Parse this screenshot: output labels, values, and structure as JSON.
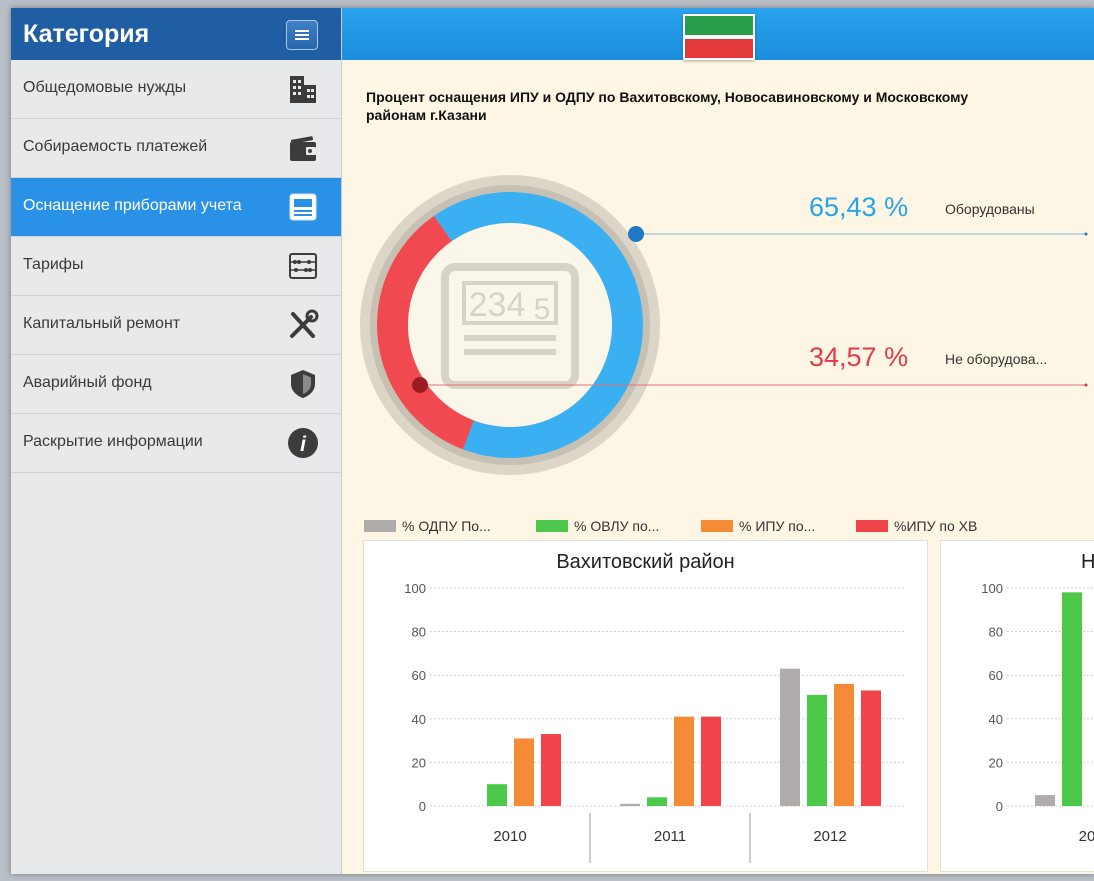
{
  "sidebar": {
    "title": "Категория",
    "items": [
      {
        "label": "Общедомовые нужды",
        "icon": "building-icon"
      },
      {
        "label": "Собираемость платежей",
        "icon": "wallet-icon"
      },
      {
        "label": "Оснащение приборами учета",
        "icon": "meter-icon",
        "active": true
      },
      {
        "label": "Тарифы",
        "icon": "abacus-icon"
      },
      {
        "label": "Капитальный ремонт",
        "icon": "tools-icon"
      },
      {
        "label": "Аварийный фонд",
        "icon": "shield-icon"
      },
      {
        "label": "Раскрытие информации",
        "icon": "info-icon"
      }
    ]
  },
  "colors": {
    "header_blue": "#1f5ea3",
    "active_blue": "#2a92e6",
    "donut_blue": "#3ab0f2",
    "donut_red": "#f04a50",
    "grey": "#b0acab",
    "green": "#4cc84a",
    "orange": "#f58b35",
    "red": "#f0434a"
  },
  "main": {
    "title": "Процент оснащения ИПУ и ОДПУ по Вахитовскому, Новосавиновскому и Московскому районам г.Казани",
    "meter_display": "234",
    "meter_display_small": "5",
    "equipped": {
      "value": "65,43 %",
      "label": "Оборудованы"
    },
    "not_equipped": {
      "value": "34,57 %",
      "label": "Не оборудова..."
    },
    "legend": [
      {
        "label": "% ОДПУ По...",
        "color": "#b0acab"
      },
      {
        "label": "% ОВЛУ по...",
        "color": "#4cc84a"
      },
      {
        "label": "% ИПУ по...",
        "color": "#f58b35"
      },
      {
        "label": "%ИПУ по ХВ",
        "color": "#f0434a"
      }
    ],
    "panel2_title": "Н",
    "panel2_year": "20"
  },
  "chart_data": [
    {
      "type": "pie",
      "slices": [
        {
          "label": "Оборудованы",
          "value": 65.43
        },
        {
          "label": "Не оборудова...",
          "value": 34.57
        }
      ]
    },
    {
      "type": "bar",
      "title": "Вахитовский район",
      "categories": [
        "2010",
        "2011",
        "2012"
      ],
      "ylim": [
        0,
        100
      ],
      "yticks": [
        0,
        20,
        40,
        60,
        80,
        100
      ],
      "grid": true,
      "series": [
        {
          "name": "% ОДПУ По...",
          "values": [
            0,
            1,
            63
          ]
        },
        {
          "name": "% ОВЛУ по...",
          "values": [
            10,
            4,
            51
          ]
        },
        {
          "name": "% ИПУ по...",
          "values": [
            31,
            41,
            56
          ]
        },
        {
          "name": "%ИПУ по ХВ",
          "values": [
            33,
            41,
            53
          ]
        }
      ]
    },
    {
      "type": "bar",
      "title": "Н",
      "categories": [
        "20"
      ],
      "ylim": [
        0,
        100
      ],
      "yticks": [
        0,
        20,
        40,
        60,
        80,
        100
      ],
      "grid": true,
      "series": [
        {
          "name": "% ОДПУ По...",
          "values": [
            5
          ]
        },
        {
          "name": "% ОВЛУ по...",
          "values": [
            98
          ]
        }
      ]
    }
  ]
}
